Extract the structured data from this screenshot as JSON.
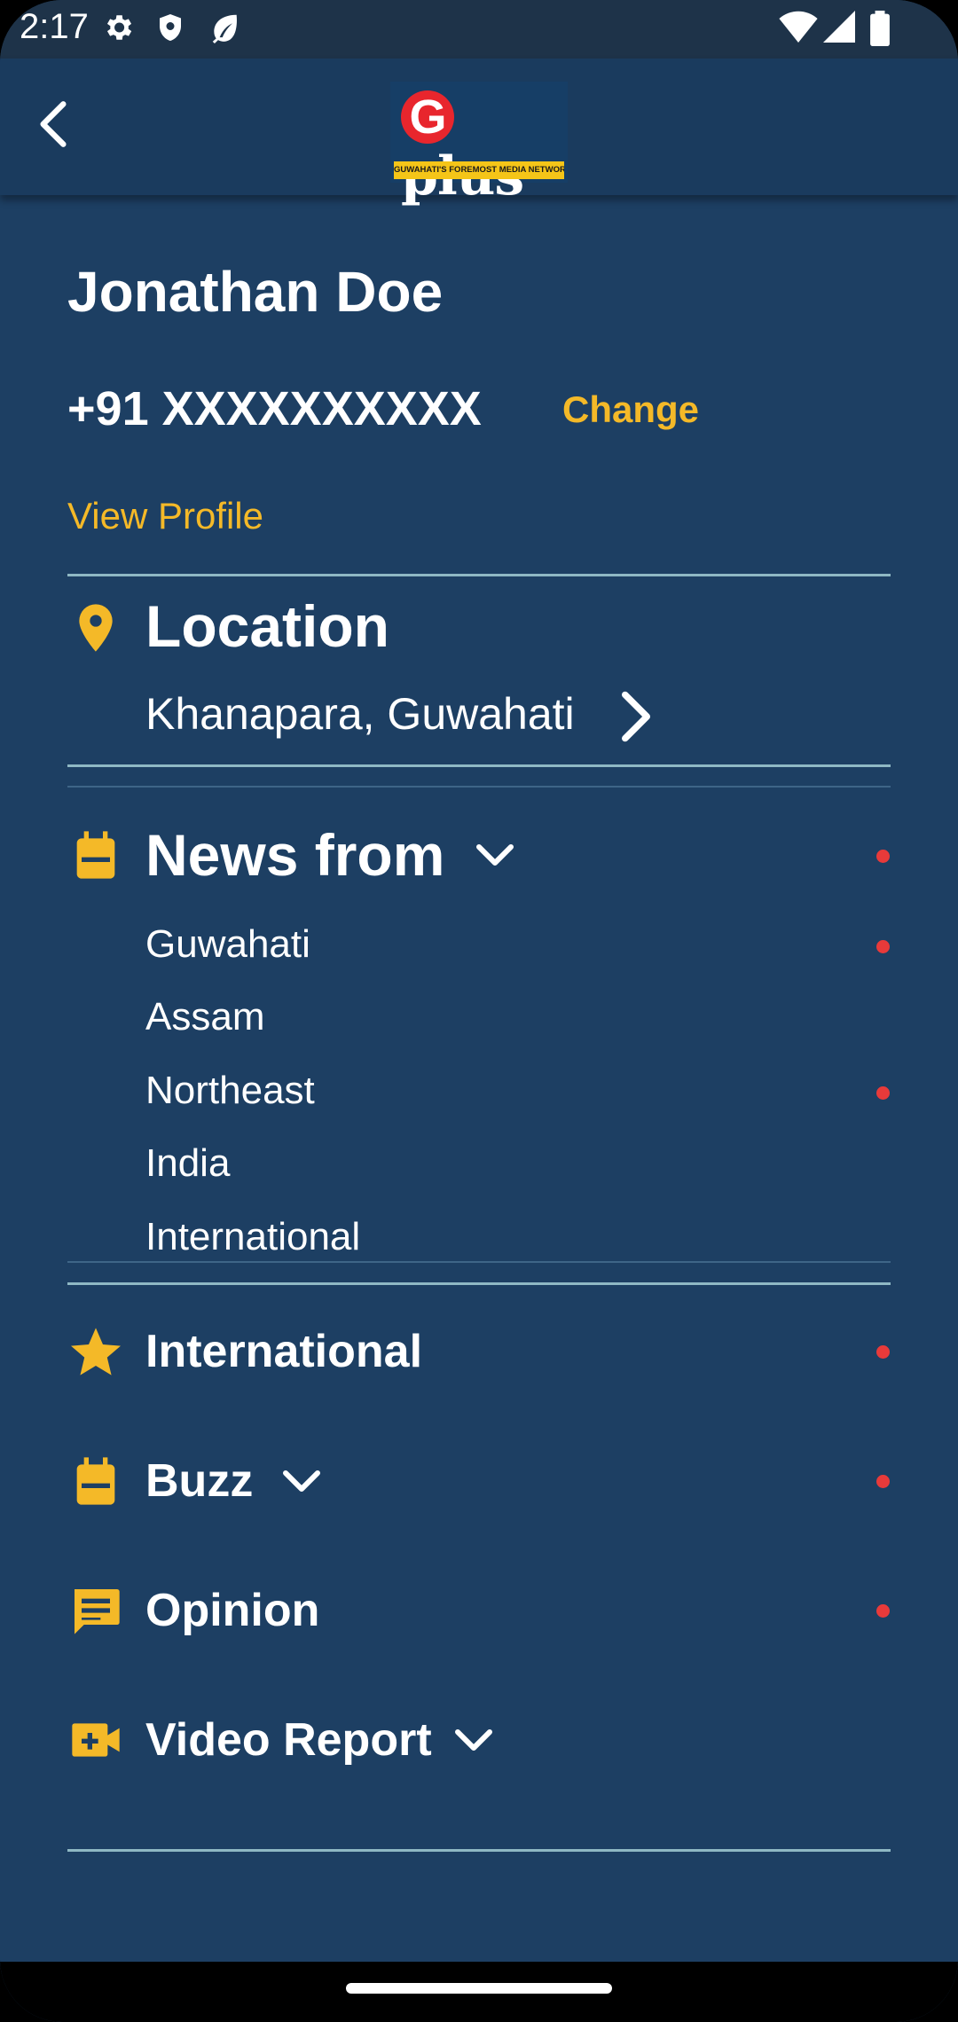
{
  "status_bar": {
    "time": "2:17",
    "icons": [
      "settings-icon",
      "shield-icon",
      "leaf-icon",
      "wifi-icon",
      "signal-icon",
      "battery-icon"
    ]
  },
  "app_bar": {
    "back_icon": "chevron-left-icon",
    "logo": {
      "letter": "G",
      "text": "plus",
      "tagline": "GUWAHATI'S FOREMOST MEDIA NETWORK"
    }
  },
  "profile": {
    "name": "Jonathan Doe",
    "phone": "+91 XXXXXXXXXX",
    "change_label": "Change",
    "view_profile_label": "View Profile"
  },
  "location": {
    "title": "Location",
    "value": "Khanapara, Guwahati",
    "icon": "location-pin-icon"
  },
  "news_from": {
    "title": "News from",
    "icon": "briefcase-icon",
    "items": [
      {
        "label": "Guwahati",
        "dot": true
      },
      {
        "label": "Assam",
        "dot": false
      },
      {
        "label": "Northeast",
        "dot": true
      },
      {
        "label": "India",
        "dot": false
      },
      {
        "label": "International",
        "dot": false
      }
    ]
  },
  "menu": [
    {
      "label": "International",
      "icon": "star-icon",
      "dot": true,
      "expandable": false
    },
    {
      "label": "Buzz",
      "icon": "briefcase-icon",
      "dot": true,
      "expandable": true
    },
    {
      "label": "Opinion",
      "icon": "comment-icon",
      "dot": true,
      "expandable": false
    },
    {
      "label": "Video Report",
      "icon": "video-add-icon",
      "dot": false,
      "expandable": true
    }
  ],
  "colors": {
    "background": "#1d3f63",
    "app_bar": "#1a3b5e",
    "accent": "#f4b928",
    "notification_dot": "#e83a3a",
    "divider": "#8fb8c4"
  }
}
